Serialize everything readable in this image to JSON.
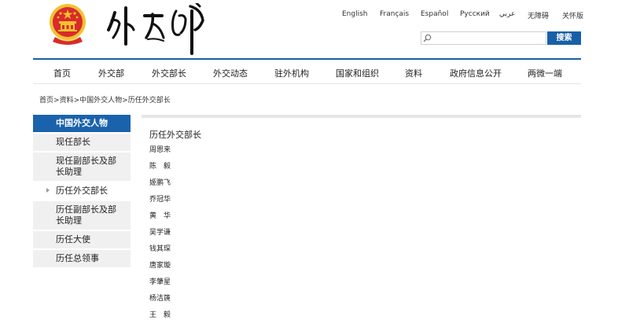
{
  "header": {
    "languages": [
      "English",
      "Français",
      "Español",
      "Русский",
      "عربي",
      "无障碍",
      "关怀版"
    ],
    "search": {
      "placeholder": "",
      "button_label": "搜索"
    }
  },
  "nav": {
    "items": [
      "首页",
      "外交部",
      "外交部长",
      "外交动态",
      "驻外机构",
      "国家和组织",
      "资料",
      "政府信息公开",
      "两微一端"
    ]
  },
  "breadcrumb": [
    "首页",
    "资料",
    "中国外交人物",
    "历任外交部长"
  ],
  "sidebar": {
    "items": [
      "中国外交人物",
      "现任部长",
      "现任副部长及部长助理",
      "历任外交部长",
      "历任副部长及部长助理",
      "历任大使",
      "历任总领事"
    ]
  },
  "content": {
    "title": "历任外交部长",
    "ministers": [
      "周恩来",
      "陈　毅",
      "姬鹏飞",
      "乔冠华",
      "黄　华",
      "吴学谦",
      "钱其琛",
      "唐家璇",
      "李肇星",
      "杨洁篪",
      "王　毅"
    ]
  },
  "colors": {
    "brand_blue": "#1a63ac",
    "sidebar_bg": "#f0f0f0",
    "emblem_red": "#d92b2b",
    "emblem_gold": "#f2c230"
  }
}
